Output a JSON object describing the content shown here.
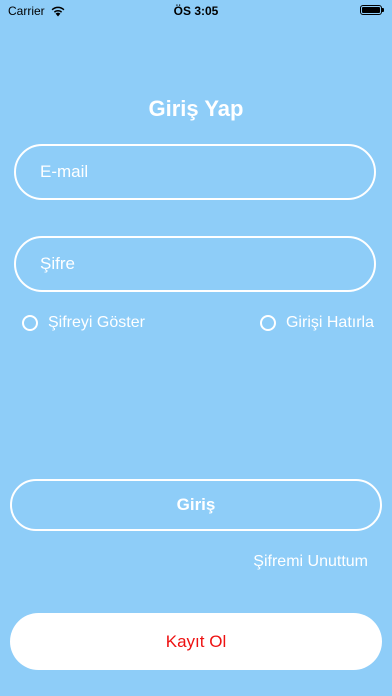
{
  "status_bar": {
    "carrier": "Carrier",
    "time": "ÖS 3:05",
    "wifi_icon": "wifi-icon",
    "battery_icon": "battery-icon"
  },
  "login": {
    "title": "Giriş Yap",
    "email_placeholder": "E-mail",
    "password_placeholder": "Şifre",
    "show_password_label": "Şifreyi Göster",
    "remember_label": "Girişi Hatırla",
    "login_button": "Giriş",
    "forgot_password": "Şifremi Unuttum",
    "register_button": "Kayıt Ol"
  },
  "colors": {
    "background": "#8ECDF8",
    "foreground": "#FFFFFF",
    "register_text": "#EE1111"
  }
}
